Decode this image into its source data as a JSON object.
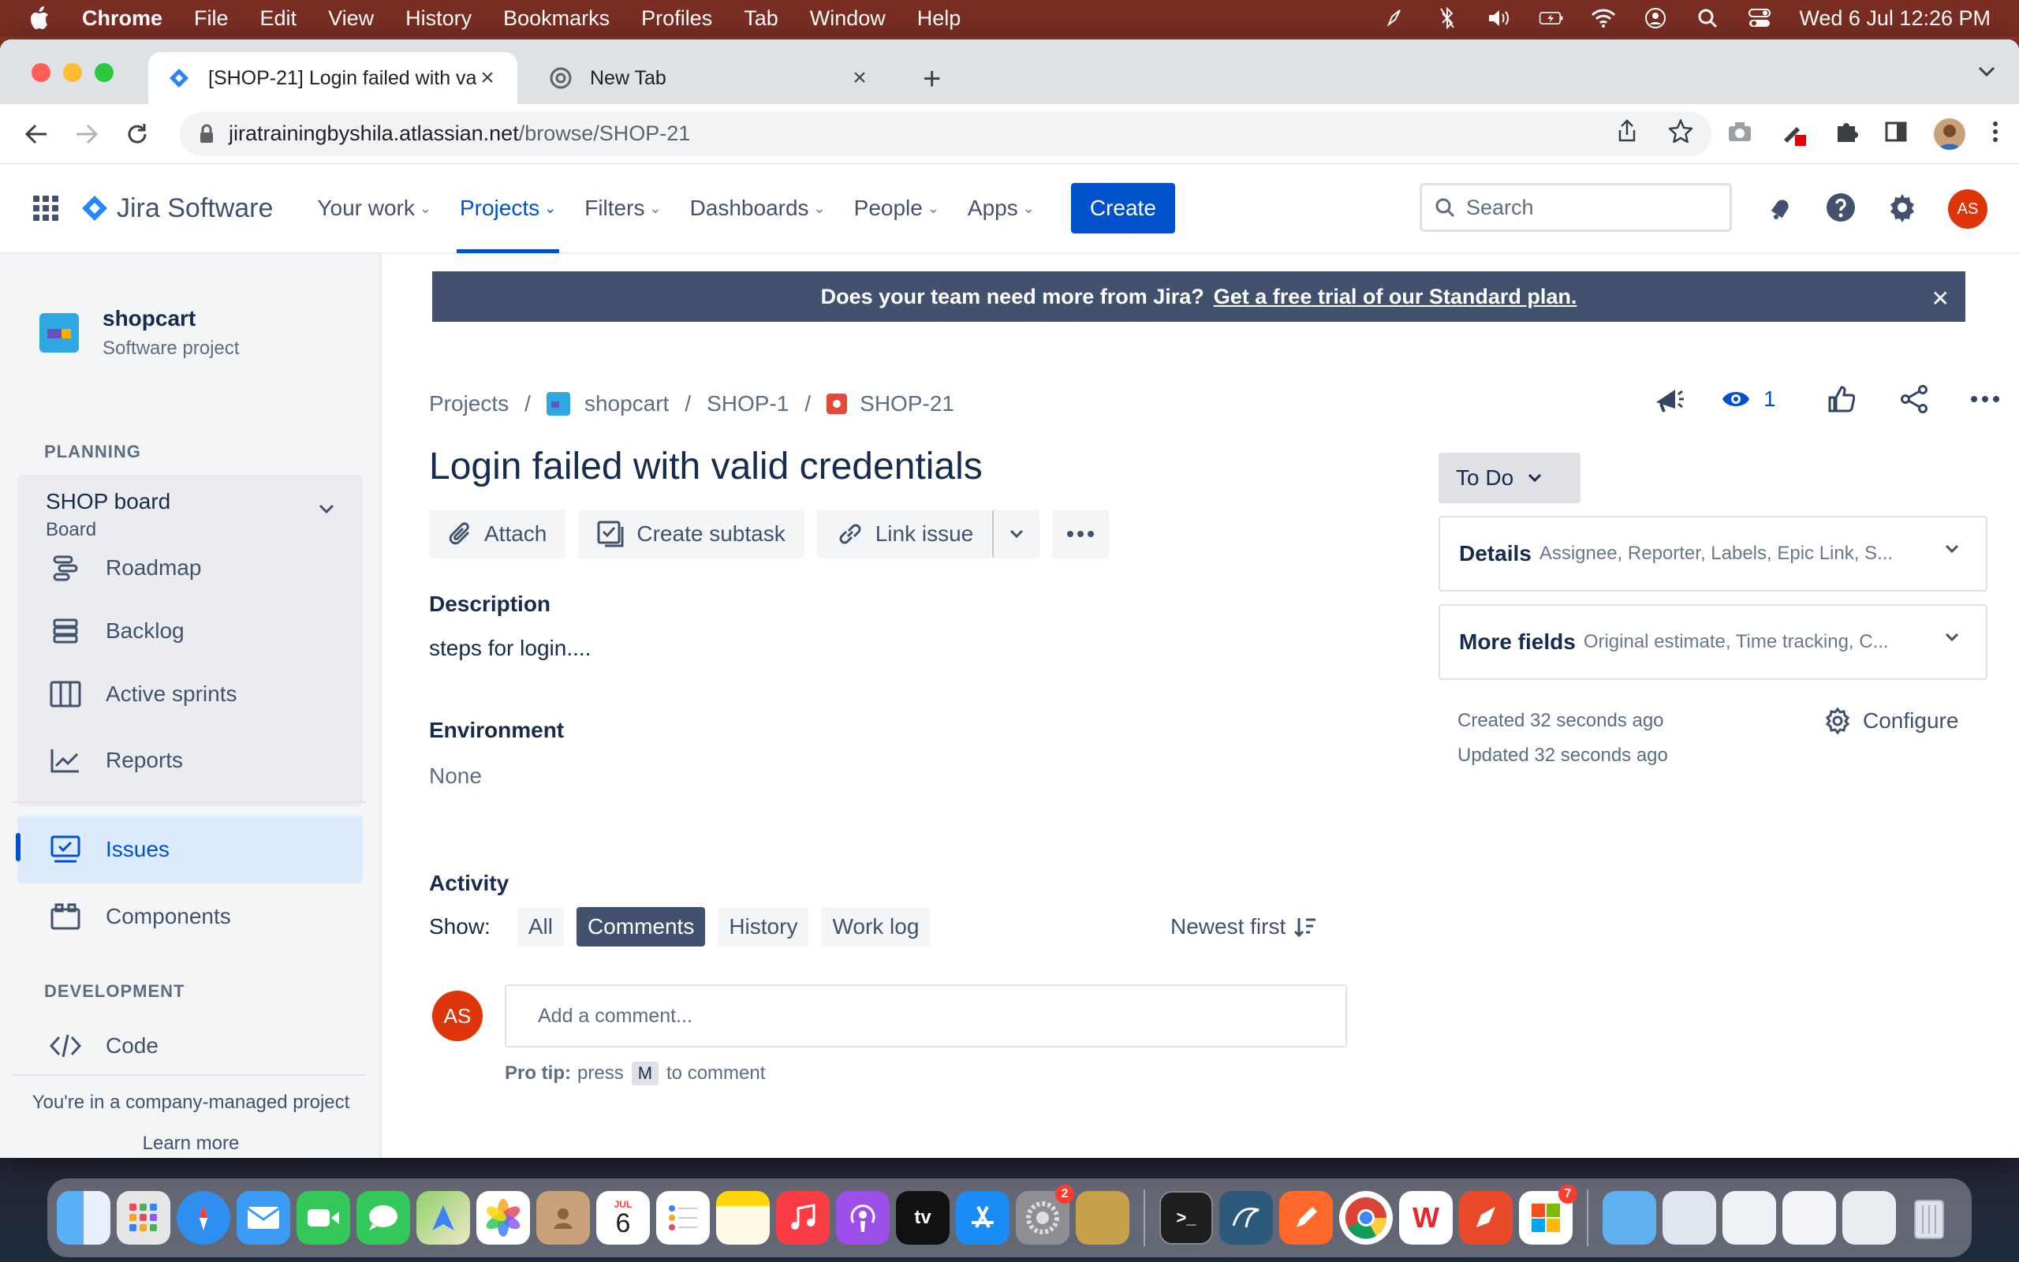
{
  "menubar": {
    "app": "Chrome",
    "items": [
      "File",
      "Edit",
      "View",
      "History",
      "Bookmarks",
      "Profiles",
      "Tab",
      "Window",
      "Help"
    ],
    "clock": "Wed 6 Jul  12:26 PM"
  },
  "browser": {
    "tabs": [
      {
        "title": "[SHOP-21] Login failed with valid credentials",
        "active": true
      },
      {
        "title": "New Tab",
        "active": false
      }
    ],
    "url_host": "jiratrainingbyshila.atlassian.net",
    "url_path": "/browse/SHOP-21"
  },
  "jira": {
    "product": "Jira Software",
    "nav": [
      {
        "label": "Your work"
      },
      {
        "label": "Projects"
      },
      {
        "label": "Filters"
      },
      {
        "label": "Dashboards"
      },
      {
        "label": "People"
      },
      {
        "label": "Apps"
      }
    ],
    "create_label": "Create",
    "search_placeholder": "Search",
    "user_initials": "AS"
  },
  "sidebar": {
    "project_name": "shopcart",
    "project_type": "Software project",
    "planning_label": "PLANNING",
    "board_name": "SHOP board",
    "board_sub": "Board",
    "items": [
      {
        "label": "Roadmap"
      },
      {
        "label": "Backlog"
      },
      {
        "label": "Active sprints"
      },
      {
        "label": "Reports"
      },
      {
        "label": "Issues"
      },
      {
        "label": "Components"
      }
    ],
    "development_label": "DEVELOPMENT",
    "code_label": "Code",
    "footer_text": "You're in a company-managed project",
    "learn_more": "Learn more"
  },
  "banner": {
    "text": "Does your team need more from Jira?",
    "link": "Get a free trial of our Standard plan."
  },
  "issue": {
    "breadcrumb": {
      "projects": "Projects",
      "project": "shopcart",
      "epic": "SHOP-1",
      "key": "SHOP-21"
    },
    "watchers": "1",
    "title": "Login failed with valid credentials",
    "actions": {
      "attach": "Attach",
      "create_subtask": "Create subtask",
      "link_issue": "Link issue"
    },
    "description_label": "Description",
    "description": "steps for login....",
    "environment_label": "Environment",
    "environment": "None",
    "activity_label": "Activity",
    "show_label": "Show:",
    "activity_filters": [
      "All",
      "Comments",
      "History",
      "Work log"
    ],
    "sort_label": "Newest first",
    "comment_placeholder": "Add a comment...",
    "protip_bold": "Pro tip:",
    "protip_press": "press",
    "protip_key": "M",
    "protip_end": "to comment"
  },
  "panel": {
    "status": "To Do",
    "details_title": "Details",
    "details_sub": "Assignee, Reporter, Labels, Epic Link, S...",
    "more_title": "More fields",
    "more_sub": "Original estimate, Time tracking, C...",
    "created": "Created 32 seconds ago",
    "updated": "Updated 32 seconds ago",
    "configure": "Configure"
  },
  "dock": {
    "calendar_month": "JUL",
    "calendar_day": "6",
    "badge_settings": "2",
    "badge_office": "7"
  },
  "colors": {
    "jira_blue": "#0052cc",
    "banner_bg": "#42526e",
    "avatar_red": "#de350b"
  }
}
